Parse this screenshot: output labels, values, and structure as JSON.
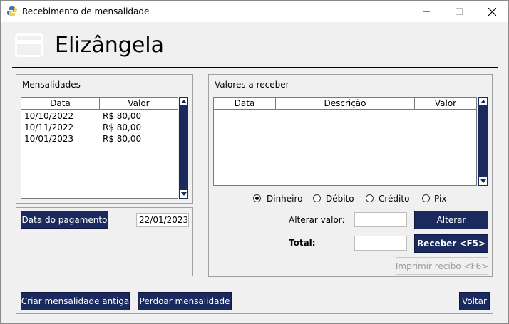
{
  "window": {
    "title": "Recebimento de mensalidade",
    "minimize_icon": "minimize-icon",
    "maximize_icon": "maximize-icon",
    "close_icon": "close-icon"
  },
  "header": {
    "card_icon": "credit-card-icon",
    "name": "Elizângela"
  },
  "mensalidades": {
    "label": "Mensalidades",
    "columns": [
      "Data",
      "Valor"
    ],
    "rows": [
      {
        "data": "10/10/2022",
        "valor": "R$ 80,00"
      },
      {
        "data": "10/11/2022",
        "valor": "R$ 80,00"
      },
      {
        "data": "10/01/2023",
        "valor": "R$ 80,00"
      }
    ]
  },
  "pagamento": {
    "button_label": "Data do pagamento",
    "date_value": "22/01/2023"
  },
  "valores": {
    "label": "Valores a receber",
    "columns": [
      "Data",
      "Descrição",
      "Valor"
    ],
    "rows": []
  },
  "payment_methods": {
    "options": [
      "Dinheiro",
      "Débito",
      "Crédito",
      "Pix"
    ],
    "selected": "Dinheiro"
  },
  "alterar": {
    "label": "Alterar valor:",
    "value": "",
    "button_label": "Alterar"
  },
  "total": {
    "label": "Total:",
    "value": ""
  },
  "actions": {
    "receber_label": "Receber <F5>",
    "imprimir_label": "Imprimir recibo <F6>",
    "criar_label": "Criar mensalidade antiga",
    "perdoar_label": "Perdoar mensalidade",
    "voltar_label": "Voltar"
  },
  "colors": {
    "button_navy": "#1b2a5e",
    "window_bg": "#f0f0f0"
  }
}
